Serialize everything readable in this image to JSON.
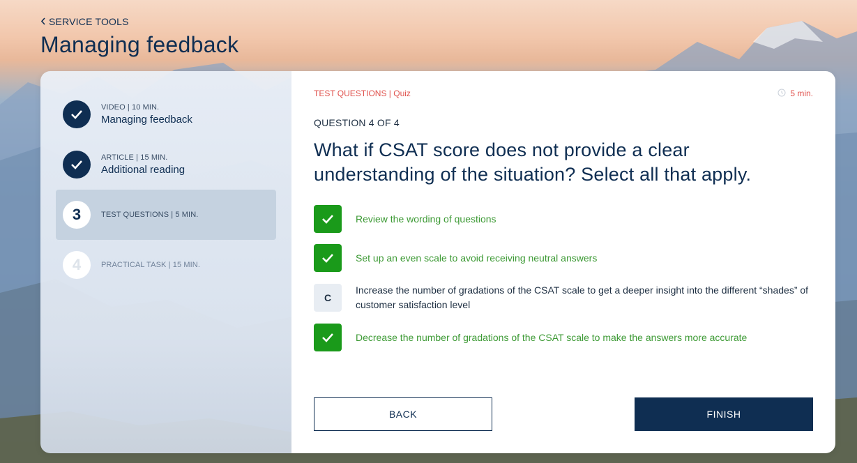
{
  "header": {
    "breadcrumb": "SERVICE TOOLS",
    "title": "Managing feedback"
  },
  "sidebar": {
    "steps": [
      {
        "state": "done",
        "meta": "VIDEO | 10 MIN.",
        "name": "Managing feedback"
      },
      {
        "state": "done",
        "meta": "ARTICLE | 15 MIN.",
        "name": "Additional reading"
      },
      {
        "state": "current",
        "number": "3",
        "meta": "TEST QUESTIONS | 5 MIN."
      },
      {
        "state": "locked",
        "number": "4",
        "meta": "PRACTICAL TASK | 15 MIN."
      }
    ]
  },
  "quiz": {
    "section_label": "TEST QUESTIONS | Quiz",
    "duration": "5 min.",
    "question_count": "QUESTION 4 OF 4",
    "question": "What if CSAT score does not provide a clear understanding of the situation? Select all that apply.",
    "answers": [
      {
        "state": "checked",
        "text": "Review the wording of questions"
      },
      {
        "state": "checked",
        "text": "Set up an even scale to avoid receiving neutral answers"
      },
      {
        "state": "unchecked",
        "letter": "C",
        "text": "Increase the number of gradations of the CSAT scale to get a deeper insight into the different “shades” of customer satisfaction level"
      },
      {
        "state": "checked",
        "text": "Decrease the number of gradations of the CSAT scale to make the answers more accurate"
      }
    ],
    "back_label": "BACK",
    "finish_label": "FINISH"
  },
  "colors": {
    "navy": "#0f2e52",
    "accent_red": "#e0524d",
    "correct_green": "#1a9a1a",
    "correct_text": "#3d9a35"
  },
  "icons": {
    "back": "chevron-left-icon",
    "done": "check-icon",
    "duration": "clock-icon"
  }
}
